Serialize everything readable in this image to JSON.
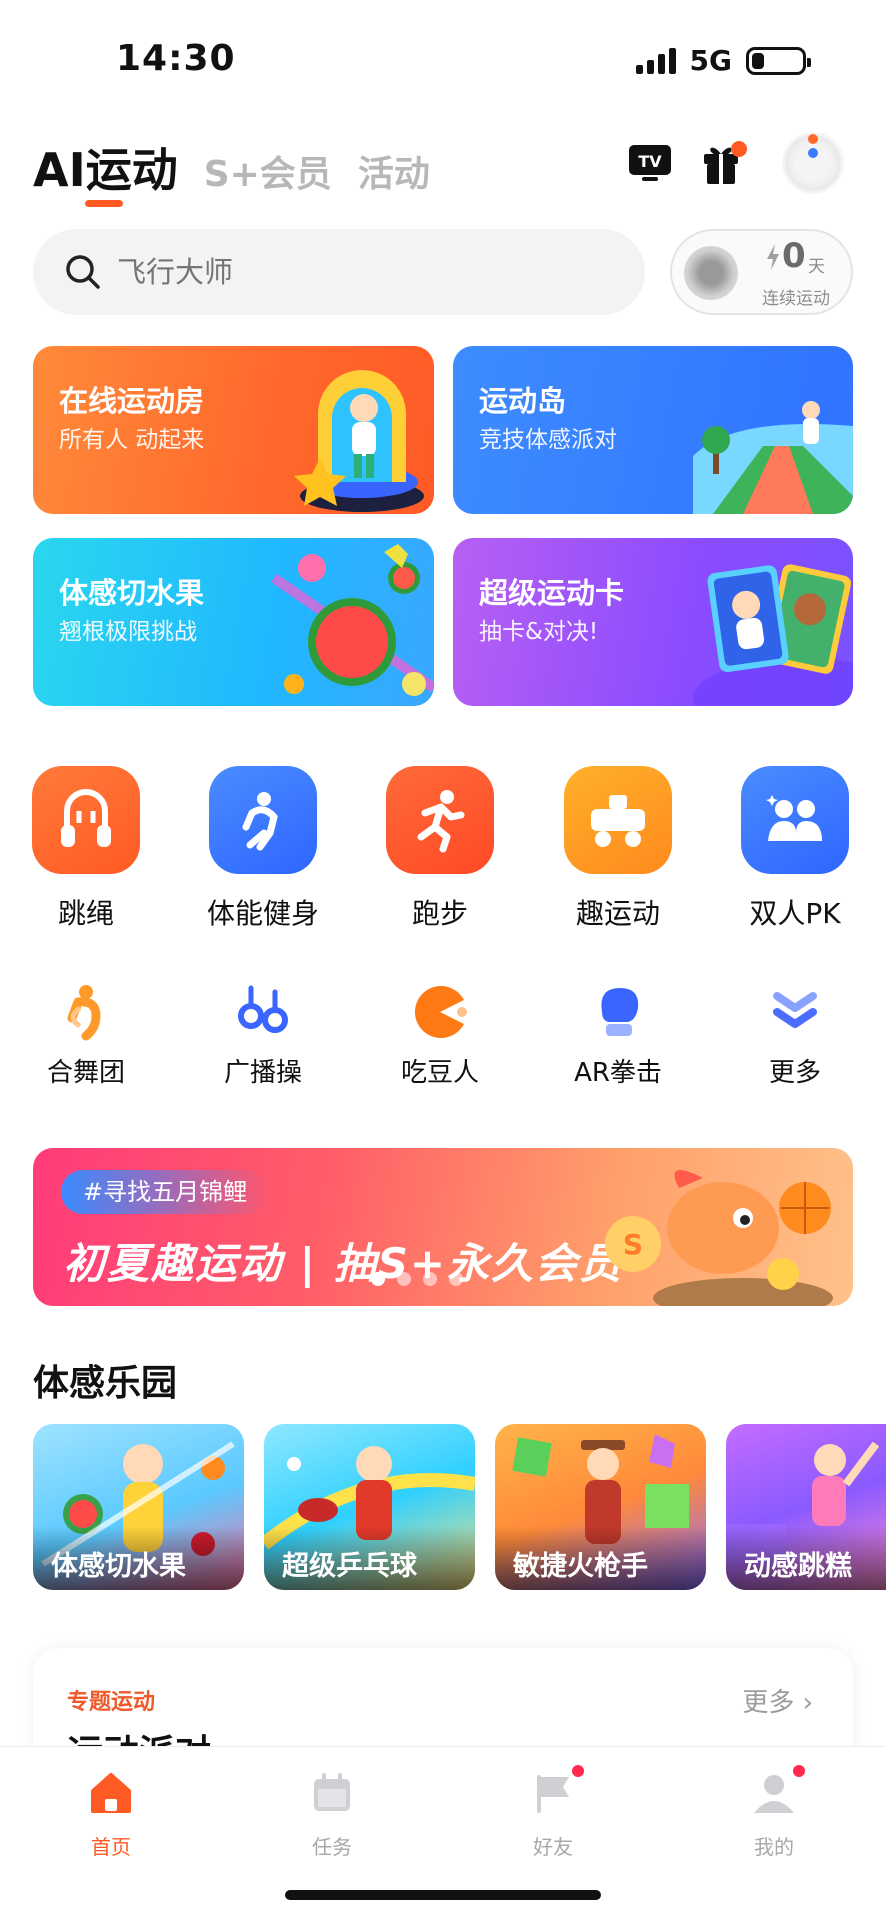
{
  "status_bar": {
    "time": "14:30",
    "network": "5G",
    "battery_level": 0.25
  },
  "header": {
    "tabs": [
      "AI运动",
      "S+会员",
      "活动"
    ],
    "active_tab": 0,
    "tv_label": "TV"
  },
  "search": {
    "placeholder": "飞行大师"
  },
  "streak": {
    "count": "0",
    "unit": "天",
    "label": "连续运动"
  },
  "feature_cards": [
    {
      "title": "在线运动房",
      "subtitle": "所有人 动起来"
    },
    {
      "title": "运动岛",
      "subtitle": "竞技体感派对"
    },
    {
      "title": "体感切水果",
      "subtitle": "翘根极限挑战"
    },
    {
      "title": "超级运动卡",
      "subtitle": "抽卡&对决!"
    }
  ],
  "main_categories": [
    {
      "label": "跳绳",
      "icon": "jump-rope-icon"
    },
    {
      "label": "体能健身",
      "icon": "fitness-icon"
    },
    {
      "label": "跑步",
      "icon": "running-icon"
    },
    {
      "label": "趣运动",
      "icon": "fun-sport-icon"
    },
    {
      "label": "双人PK",
      "icon": "duo-pk-icon"
    }
  ],
  "sub_categories": [
    {
      "label": "合舞团",
      "icon": "dance-icon"
    },
    {
      "label": "广播操",
      "icon": "broadcast-exercise-icon"
    },
    {
      "label": "吃豆人",
      "icon": "pacman-icon"
    },
    {
      "label": "AR拳击",
      "icon": "boxing-glove-icon"
    },
    {
      "label": "更多",
      "icon": "chevron-down-double-icon"
    }
  ],
  "banner": {
    "tag": "#寻找五月锦鲤",
    "title": "初夏趣运动 | 抽S+永久会员",
    "slide_count": 4,
    "active_slide": 0
  },
  "motion_park": {
    "title": "体感乐园",
    "games": [
      "体感切水果",
      "超级乒乓球",
      "敏捷火枪手",
      "动感跳糕"
    ]
  },
  "topic": {
    "tag": "专题运动",
    "more": "更多",
    "title": "运动派对"
  },
  "tab_bar": {
    "items": [
      {
        "label": "首页",
        "active": true,
        "badge": false
      },
      {
        "label": "任务",
        "active": false,
        "badge": false
      },
      {
        "label": "好友",
        "active": false,
        "badge": true
      },
      {
        "label": "我的",
        "active": false,
        "badge": true
      }
    ]
  },
  "colors": {
    "accent": "#ff5a24",
    "badge": "#ff2a4d"
  }
}
